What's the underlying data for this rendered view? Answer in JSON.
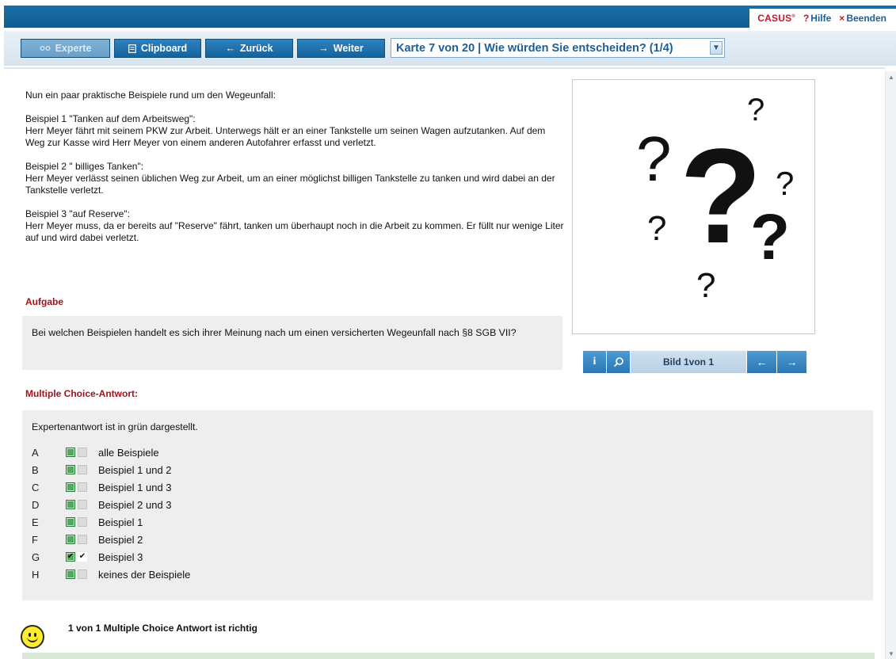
{
  "header": {
    "brand": "CASUS",
    "brand_mark": "®",
    "help_label": "Hilfe",
    "help_icon": "?",
    "exit_label": "Beenden",
    "exit_icon": "×"
  },
  "toolbar": {
    "expert_label": "Experte",
    "clipboard_label": "Clipboard",
    "back_label": "Zurück",
    "next_label": "Weiter",
    "card_select_value": "Karte 7 von 20 | Wie würden Sie entscheiden? (1/4)"
  },
  "intro": {
    "lead": "Nun ein paar praktische Beispiele rund um den Wegeunfall:",
    "examples": [
      {
        "title": "Beispiel 1 \"Tanken auf dem Arbeitsweg\":",
        "text": "Herr Meyer fährt mit seinem PKW zur Arbeit. Unterwegs hält er an einer Tankstelle um seinen Wagen aufzutanken. Auf dem Weg zur Kasse wird Herr Meyer von einem anderen Autofahrer erfasst und verletzt."
      },
      {
        "title": "Beispiel 2 \" billiges Tanken\":",
        "text": "Herr Meyer verlässt seinen üblichen Weg zur Arbeit, um an einer möglichst billigen Tankstelle zu tanken und wird dabei an der Tankstelle verletzt."
      },
      {
        "title": "Beispiel 3 \"auf Reserve\":",
        "text": "Herr Meyer muss, da er bereits auf \"Reserve\" fährt, tanken um überhaupt noch in die Arbeit zu kommen. Er füllt nur wenige Liter auf und wird dabei verletzt."
      }
    ]
  },
  "task": {
    "heading": "Aufgabe",
    "text": "Bei welchen Beispielen handelt es sich ihrer Meinung nach um einen versicherten Wegeunfall nach §8 SGB VII?"
  },
  "mc": {
    "heading": "Multiple Choice-Antwort:",
    "note": "Expertenantwort ist in grün dargestellt.",
    "options": [
      {
        "letter": "A",
        "label": "alle Beispiele",
        "expert_checked": false,
        "user_checked": false
      },
      {
        "letter": "B",
        "label": "Beispiel 1 und 2",
        "expert_checked": false,
        "user_checked": false
      },
      {
        "letter": "C",
        "label": "Beispiel 1 und 3",
        "expert_checked": false,
        "user_checked": false
      },
      {
        "letter": "D",
        "label": "Beispiel 2 und 3",
        "expert_checked": false,
        "user_checked": false
      },
      {
        "letter": "E",
        "label": "Beispiel 1",
        "expert_checked": false,
        "user_checked": false
      },
      {
        "letter": "F",
        "label": "Beispiel 2",
        "expert_checked": false,
        "user_checked": false
      },
      {
        "letter": "G",
        "label": "Beispiel 3",
        "expert_checked": true,
        "user_checked": true
      },
      {
        "letter": "H",
        "label": "keines der Beispiele",
        "expert_checked": false,
        "user_checked": false
      }
    ],
    "result_count": "1 von 1",
    "result_rest": " Multiple Choice Antwort ist richtig"
  },
  "image_viewer": {
    "counter_bold": "Bild 1",
    "counter_rest": " von 1",
    "info_icon": "i",
    "prev_icon": "←",
    "next_icon": "→"
  },
  "colors": {
    "header_blue": "#1a6fa8",
    "brand_red": "#c4142a",
    "heading_red": "#a3111f",
    "expert_green": "#52a861"
  }
}
